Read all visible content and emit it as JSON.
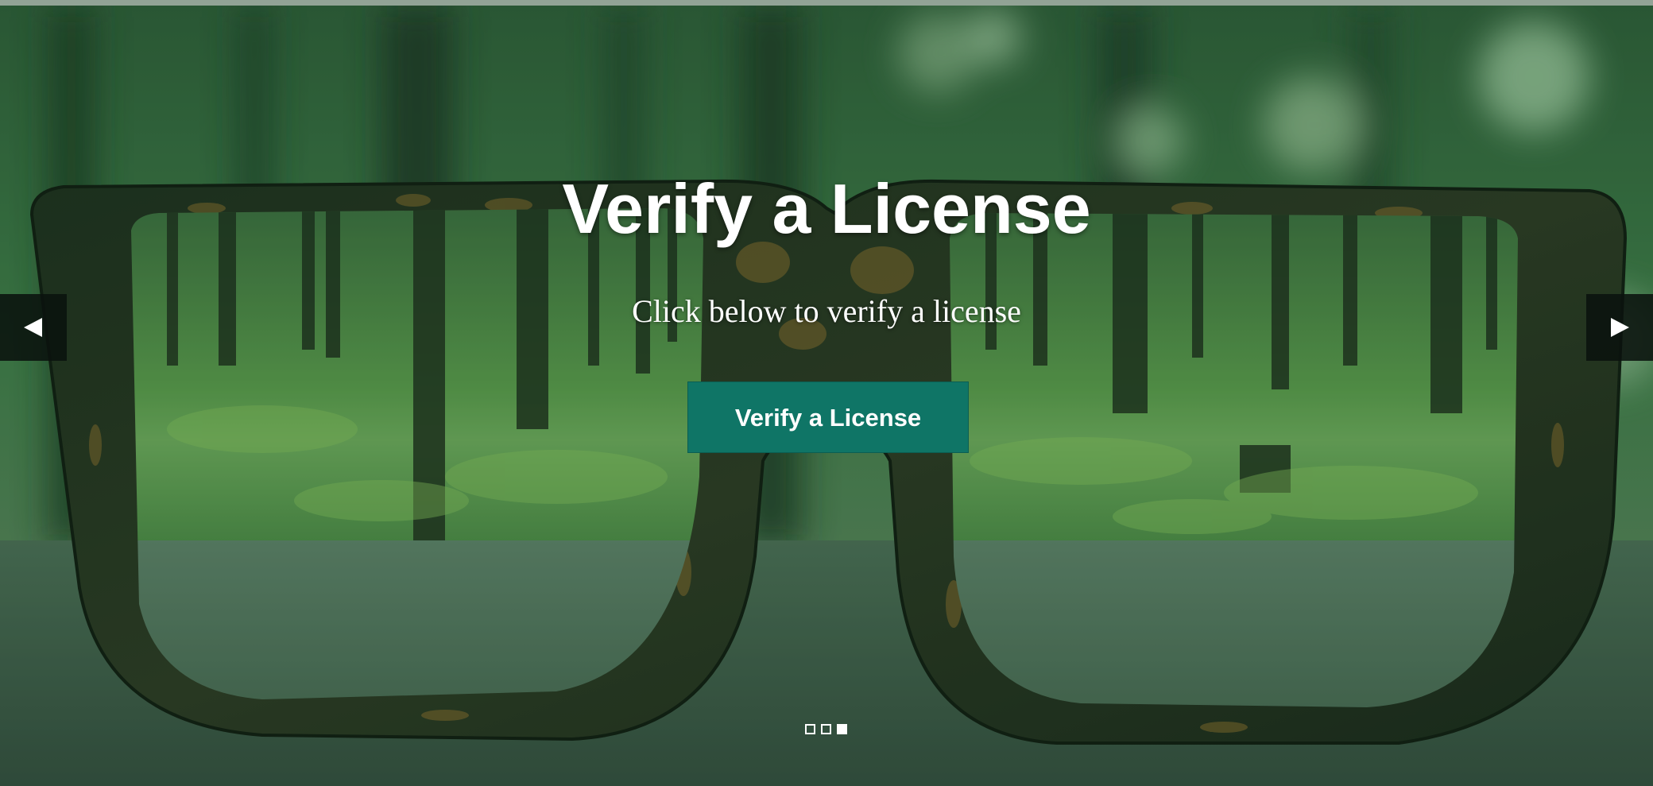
{
  "hero": {
    "title": "Verify a License",
    "subtitle": "Click below to verify a license",
    "button_label": "Verify a License"
  },
  "carousel": {
    "prev_icon": "triangle-left-icon",
    "next_icon": "triangle-right-icon",
    "slide_count": 3,
    "active_slide": 3
  },
  "colors": {
    "button": "#0f7566",
    "overlay": "#14462d",
    "text": "#ffffff"
  }
}
